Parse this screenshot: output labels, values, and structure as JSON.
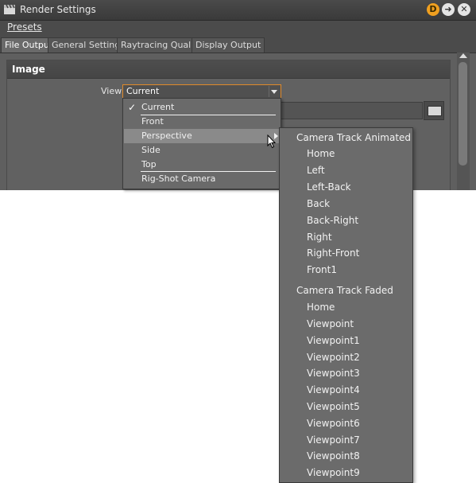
{
  "window": {
    "title": "Render Settings",
    "title_buttons": {
      "d_label": "D"
    },
    "menu": {
      "presets_label": "Presets"
    }
  },
  "tabs": [
    "File Output",
    "General Settings",
    "Raytracing Quality",
    "Display Output"
  ],
  "active_tab": "File Output",
  "panel": {
    "title": "Image",
    "view_label": "View",
    "view_value": "Current"
  },
  "view_dropdown": {
    "items": [
      "Current",
      "Front",
      "Perspective",
      "Side",
      "Top",
      "Rig-Shot Camera"
    ],
    "checked": "Current",
    "highlighted": "Perspective"
  },
  "submenu": {
    "groups": [
      {
        "header": "Camera Track Animated",
        "items": [
          "Home",
          "Left",
          "Left-Back",
          "Back",
          "Back-Right",
          "Right",
          "Right-Front",
          "Front1"
        ]
      },
      {
        "header": "Camera Track Faded",
        "items": [
          "Home",
          "Viewpoint",
          "Viewpoint1",
          "Viewpoint2",
          "Viewpoint3",
          "Viewpoint4",
          "Viewpoint5",
          "Viewpoint6",
          "Viewpoint7",
          "Viewpoint8",
          "Viewpoint9"
        ]
      }
    ]
  },
  "colors": {
    "window_bg": "#5f5f5f",
    "accent_orange": "#e08a2a",
    "highlight": "#8a8a8a"
  }
}
